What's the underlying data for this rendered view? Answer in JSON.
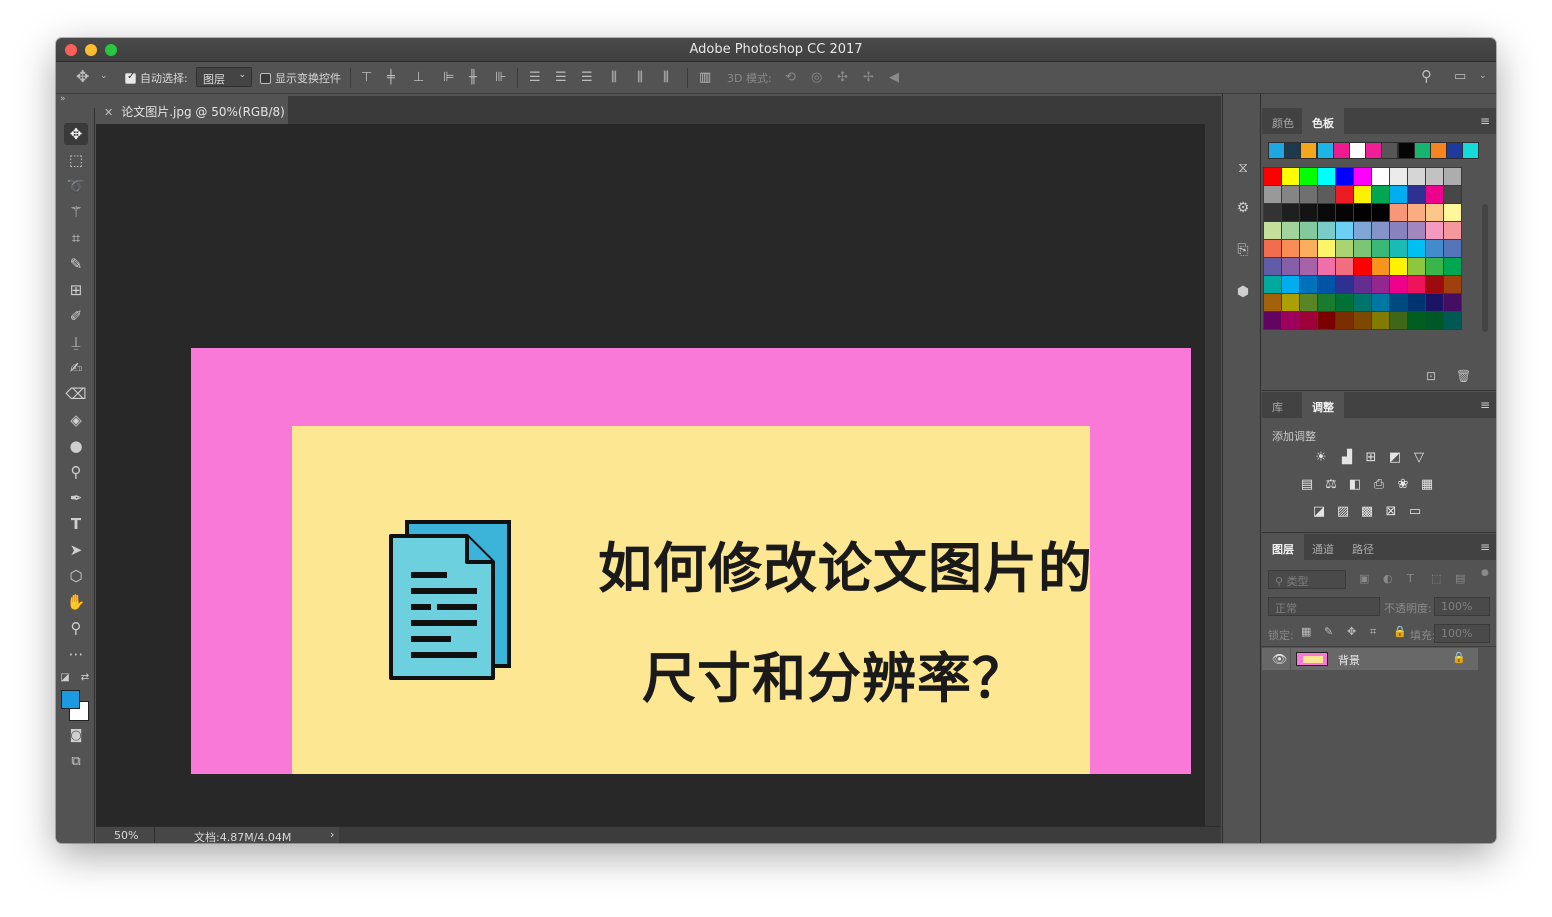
{
  "app": {
    "title": "Adobe Photoshop CC 2017"
  },
  "options_bar": {
    "auto_select_label": "自动选择:",
    "auto_select_checked": true,
    "target_value": "图层",
    "show_transform_label": "显示变换控件",
    "show_transform_checked": false,
    "mode_3d_label": "3D 模式:"
  },
  "document": {
    "tab_label": "论文图片.jpg @ 50%(RGB/8)",
    "zoom": "50%",
    "doc_size": "文档:4.87M/4.04M",
    "image_title_line1": "如何修改论文图片的",
    "image_title_line2": "尺寸和分辨率？",
    "outer_color": "#f979d8",
    "inner_color": "#fee792"
  },
  "tools": [
    "move-tool",
    "marquee-tool",
    "lasso-tool",
    "magic-wand-tool",
    "crop-tool",
    "eyedropper-tool",
    "healing-tool",
    "brush-tool",
    "stamp-tool",
    "history-brush-tool",
    "eraser-tool",
    "paint-bucket-tool",
    "blur-tool",
    "dodge-tool",
    "pen-tool",
    "type-tool",
    "path-select-tool",
    "shape-tool",
    "hand-tool",
    "zoom-tool",
    "more-tools"
  ],
  "colors": {
    "foreground": "#1b9ae1",
    "background": "#ffffff"
  },
  "swatches_panel": {
    "tabs": [
      "颜色",
      "色板"
    ],
    "active_tab": "色板",
    "recent": [
      "#1ea7e1",
      "#1f3a4e",
      "#f4a71d",
      "#1eb4e6",
      "#ef1a8f",
      "#ffffff",
      "#f01f97",
      "#565656",
      "#050505",
      "#16b46f",
      "#f58421",
      "#1e3a9e",
      "#14dada"
    ],
    "grid": [
      [
        "#ff0000",
        "#ffff00",
        "#00ff00",
        "#00ffff",
        "#0000ff",
        "#ff00ff",
        "#ffffff",
        "#ebebeb",
        "#d6d6d6",
        "#c2c2c2",
        "#adadad"
      ],
      [
        "#999999",
        "#858585",
        "#707070",
        "#5c5c5c",
        "#ed1c24",
        "#fff200",
        "#00a651",
        "#00aeef",
        "#2e3192",
        "#ec008c",
        "#474747"
      ],
      [
        "#333333",
        "#1f1f1f",
        "#141414",
        "#0a0a0a",
        "#050505",
        "#000000",
        "#000000",
        "#f7977a",
        "#f9ad81",
        "#fdc68a",
        "#fff79a"
      ],
      [
        "#c4df9b",
        "#a3d39c",
        "#82ca9d",
        "#7accc8",
        "#6dcff6",
        "#7ea7d8",
        "#8493ca",
        "#8882be",
        "#a187be",
        "#f49ac1",
        "#f5989d"
      ],
      [
        "#f26c4f",
        "#f68e55",
        "#fbaf5c",
        "#fff467",
        "#acd372",
        "#7cc576",
        "#3bb878",
        "#1abbb4",
        "#00bff3",
        "#438ccb",
        "#5574b9"
      ],
      [
        "#605ca8",
        "#855fa8",
        "#a763a8",
        "#f06ea9",
        "#f26d7d",
        "#ff0000",
        "#f7941d",
        "#fff200",
        "#8dc73f",
        "#39b54a",
        "#00a650"
      ],
      [
        "#00a99d",
        "#00aeef",
        "#0072bc",
        "#0054a6",
        "#2e3192",
        "#662d91",
        "#92278f",
        "#ec008c",
        "#ed145b",
        "#9e0b0f",
        "#a0410d"
      ],
      [
        "#a36209",
        "#aba000",
        "#598527",
        "#197b30",
        "#007236",
        "#00746b",
        "#0076a3",
        "#004a80",
        "#003471",
        "#1b1464",
        "#440e62"
      ],
      [
        "#630460",
        "#9e005d",
        "#9e0039",
        "#790000",
        "#7b2e00",
        "#7d4900",
        "#827b00",
        "#406618",
        "#005e20",
        "#005826",
        "#005952"
      ]
    ]
  },
  "adjustments_panel": {
    "tabs": [
      "库",
      "调整"
    ],
    "active_tab": "调整",
    "add_label": "添加调整"
  },
  "layers_panel": {
    "tabs": [
      "图层",
      "通道",
      "路径"
    ],
    "active_tab": "图层",
    "kind_filter": "类型",
    "blend_mode": "正常",
    "opacity_label": "不透明度:",
    "opacity_value": "100%",
    "lock_label": "锁定:",
    "fill_label": "填充:",
    "fill_value": "100%",
    "layers": [
      {
        "name": "背景",
        "visible": true,
        "locked": true
      }
    ]
  }
}
